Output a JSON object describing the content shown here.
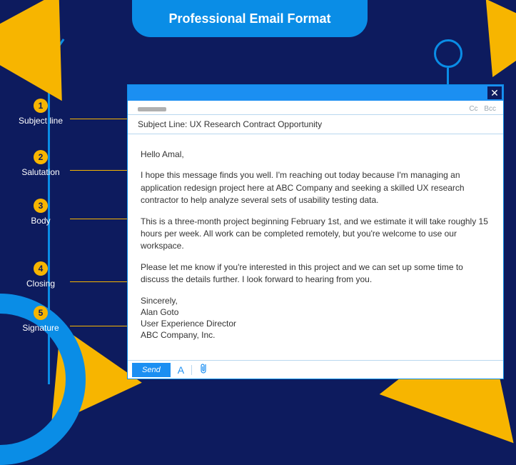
{
  "title": "Professional Email Format",
  "annotations": [
    {
      "num": "1",
      "label": "Subject line"
    },
    {
      "num": "2",
      "label": "Salutation"
    },
    {
      "num": "3",
      "label": "Body"
    },
    {
      "num": "4",
      "label": "Closing"
    },
    {
      "num": "5",
      "label": "Signature"
    }
  ],
  "email": {
    "cc": "Cc",
    "bcc": "Bcc",
    "subject": "Subject Line: UX Research Contract Opportunity",
    "salutation": "Hello Amal,",
    "para1": "I hope this message finds you well. I'm reaching out today because I'm managing an application redesign project here at ABC Company and seeking a skilled UX research contractor to help analyze several sets of usability testing data.",
    "para2": "This is a three-month project beginning February 1st, and we estimate it will take roughly 15 hours per week. All work can be completed remotely, but you're welcome to use our workspace.",
    "para3": "Please let me know if you're interested in this project and we can set up some time to discuss the details further. I look forward to hearing from you.",
    "closing": "Sincerely,",
    "sig_name": "Alan Goto",
    "sig_title": "User Experience Director",
    "sig_company": "ABC Company, Inc.",
    "send": "Send"
  }
}
